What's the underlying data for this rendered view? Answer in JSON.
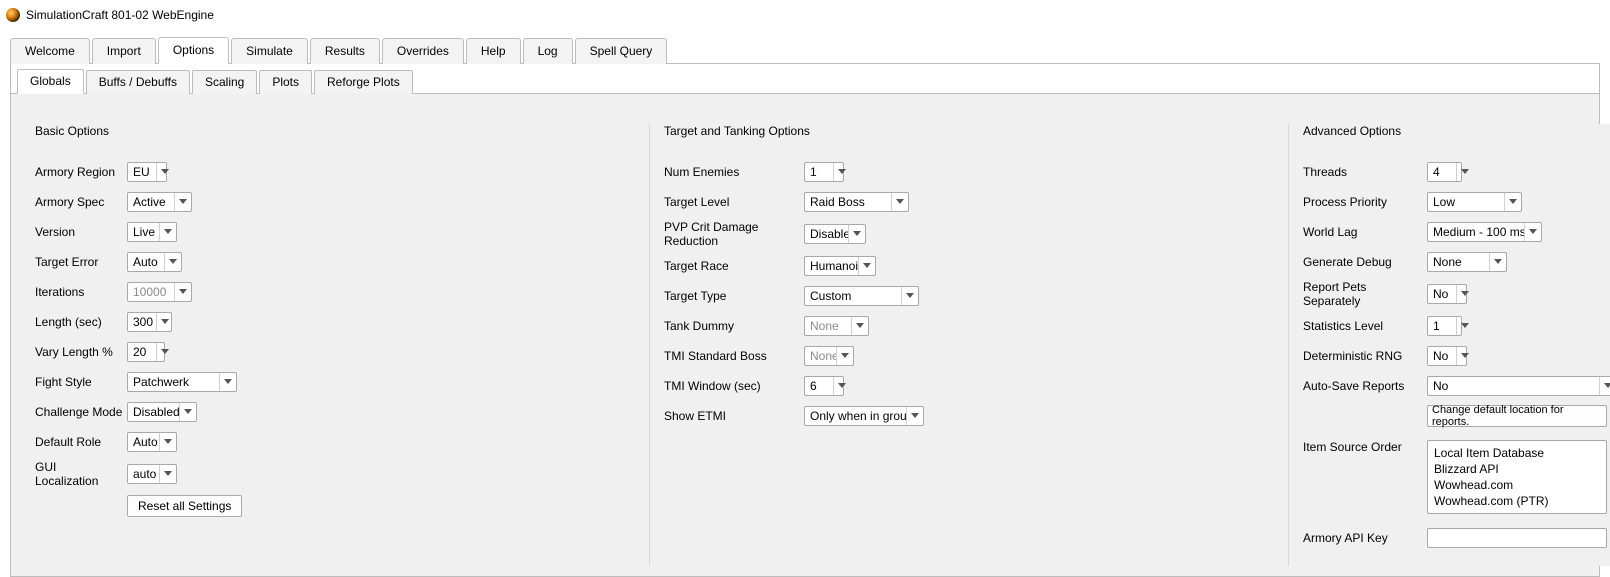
{
  "window": {
    "title": "SimulationCraft 801-02 WebEngine"
  },
  "mainTabs": [
    {
      "label": "Welcome"
    },
    {
      "label": "Import"
    },
    {
      "label": "Options",
      "active": true
    },
    {
      "label": "Simulate"
    },
    {
      "label": "Results"
    },
    {
      "label": "Overrides"
    },
    {
      "label": "Help"
    },
    {
      "label": "Log"
    },
    {
      "label": "Spell Query"
    }
  ],
  "subTabs": [
    {
      "label": "Globals",
      "active": true
    },
    {
      "label": "Buffs / Debuffs"
    },
    {
      "label": "Scaling"
    },
    {
      "label": "Plots"
    },
    {
      "label": "Reforge Plots"
    }
  ],
  "basic": {
    "title": "Basic Options",
    "armory_region": {
      "label": "Armory Region",
      "value": "EU"
    },
    "armory_spec": {
      "label": "Armory Spec",
      "value": "Active"
    },
    "version": {
      "label": "Version",
      "value": "Live"
    },
    "target_error": {
      "label": "Target Error",
      "value": "Auto"
    },
    "iterations": {
      "label": "Iterations",
      "value": "10000",
      "disabled": true
    },
    "length": {
      "label": "Length (sec)",
      "value": "300"
    },
    "vary_length": {
      "label": "Vary Length %",
      "value": "20"
    },
    "fight_style": {
      "label": "Fight Style",
      "value": "Patchwerk"
    },
    "challenge_mode": {
      "label": "Challenge Mode",
      "value": "Disabled"
    },
    "default_role": {
      "label": "Default Role",
      "value": "Auto"
    },
    "gui_localization": {
      "label": "GUI Localization",
      "value": "auto"
    },
    "reset_button": "Reset all Settings"
  },
  "target": {
    "title": "Target and Tanking Options",
    "num_enemies": {
      "label": "Num Enemies",
      "value": "1"
    },
    "target_level": {
      "label": "Target Level",
      "value": "Raid Boss"
    },
    "pvp_crit": {
      "label": "PVP Crit Damage Reduction",
      "value": "Disable"
    },
    "target_race": {
      "label": "Target Race",
      "value": "Humanoid"
    },
    "target_type": {
      "label": "Target Type",
      "value": "Custom"
    },
    "tank_dummy": {
      "label": "Tank Dummy",
      "value": "None",
      "disabled": true
    },
    "tmi_boss": {
      "label": "TMI Standard Boss",
      "value": "None",
      "disabled": true
    },
    "tmi_window": {
      "label": "TMI Window (sec)",
      "value": "6"
    },
    "show_etmi": {
      "label": "Show ETMI",
      "value": "Only when in group"
    }
  },
  "advanced": {
    "title": "Advanced Options",
    "threads": {
      "label": "Threads",
      "value": "4"
    },
    "process_priority": {
      "label": "Process Priority",
      "value": "Low"
    },
    "world_lag": {
      "label": "World Lag",
      "value": "Medium - 100 ms"
    },
    "generate_debug": {
      "label": "Generate Debug",
      "value": "None"
    },
    "report_pets": {
      "label": "Report Pets Separately",
      "value": "No"
    },
    "statistics_level": {
      "label": "Statistics Level",
      "value": "1"
    },
    "deterministic_rng": {
      "label": "Deterministic RNG",
      "value": "No"
    },
    "auto_save": {
      "label": "Auto-Save Reports",
      "value": "No"
    },
    "change_location_button": "Change default location for reports.",
    "item_source_order": {
      "label": "Item Source Order",
      "values": [
        "Local Item Database",
        "Blizzard API",
        "Wowhead.com",
        "Wowhead.com (PTR)"
      ]
    },
    "armory_api_key": {
      "label": "Armory API Key",
      "value": ""
    }
  }
}
